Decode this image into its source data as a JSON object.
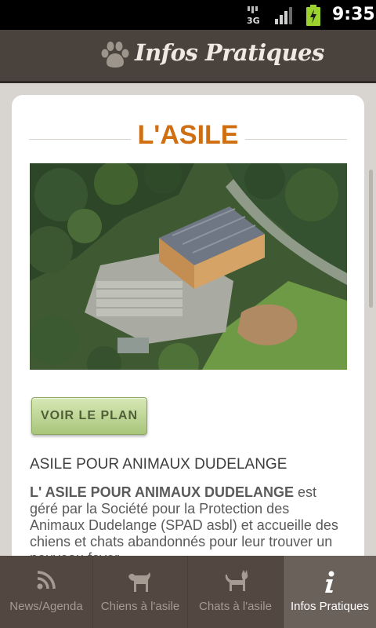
{
  "status_bar": {
    "network": "3G",
    "time": "9:35"
  },
  "header": {
    "title": "Infos Pratiques",
    "icon": "paw-icon"
  },
  "card": {
    "title": "L'ASILE",
    "photo_alt": "Vue aérienne de l'asile",
    "button_label": "VOIR LE PLAN",
    "section_heading": "ASILE POUR ANIMAUX DUDELANGE",
    "description_bold": "L' ASILE POUR ANIMAUX DUDELANGE",
    "description_rest": " est géré par la Société pour la Protection des Animaux Dudelange (SPAD asbl) et accueille des chiens et chats abandonnés pour leur trouver un nouveau foyer."
  },
  "tabs": [
    {
      "label": "News/Agenda",
      "icon": "rss-icon",
      "active": false
    },
    {
      "label": "Chiens à l'asile",
      "icon": "dog-icon",
      "active": false
    },
    {
      "label": "Chats à l'asile",
      "icon": "cat-icon",
      "active": false
    },
    {
      "label": "Infos Pratiques",
      "icon": "info-icon",
      "active": true
    }
  ],
  "colors": {
    "accent": "#d06f12",
    "header_bg": "#4a423c",
    "tabbar_bg": "#524841",
    "button_green": "#b8d38c"
  }
}
